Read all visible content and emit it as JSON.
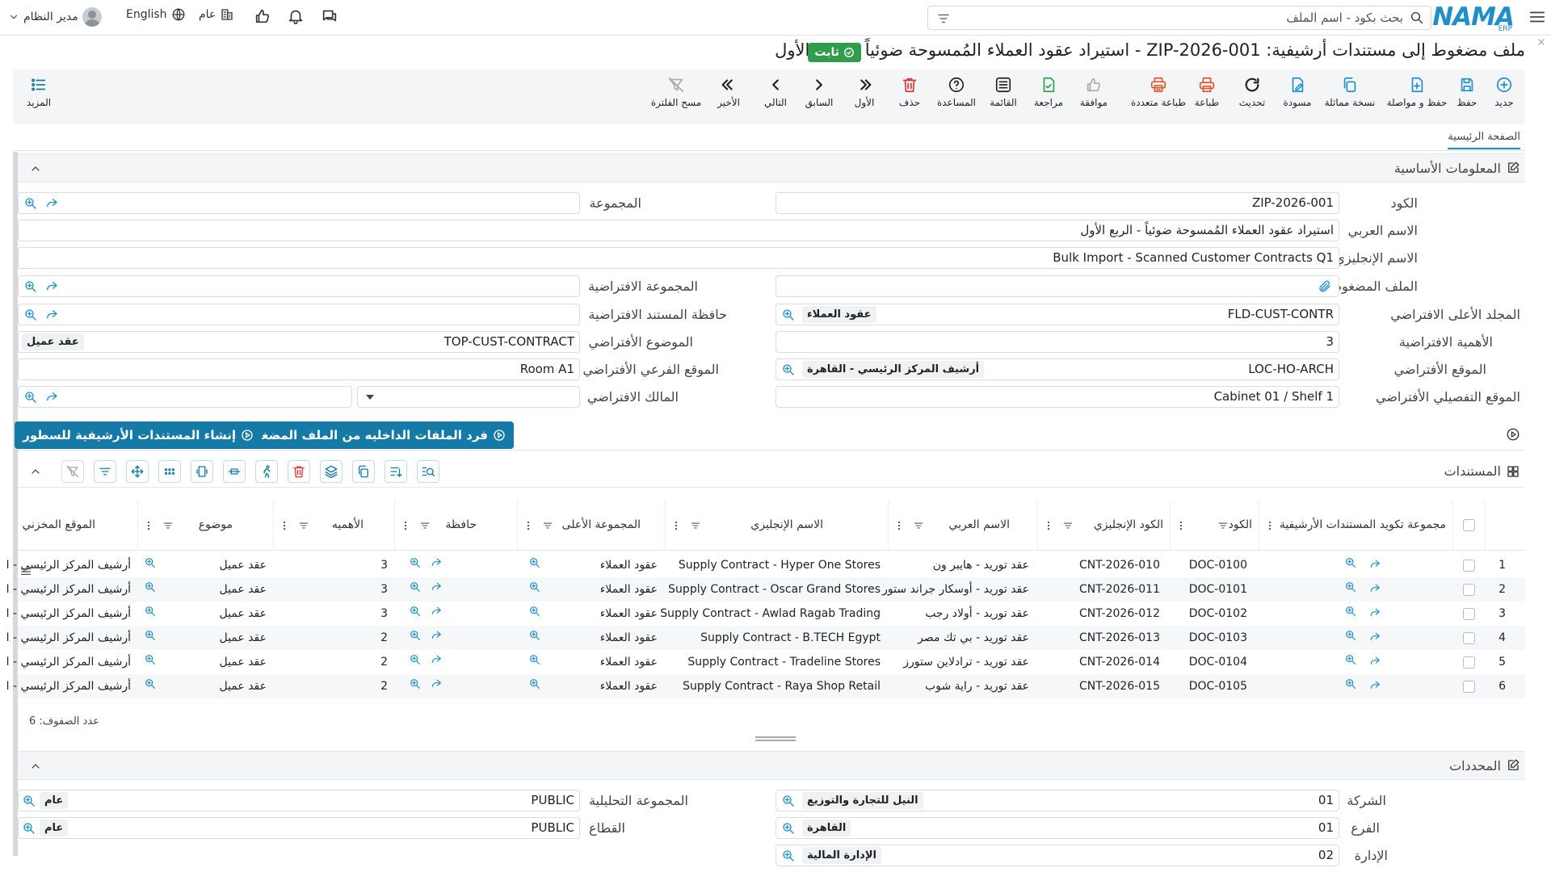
{
  "brand": {
    "logo_text": "NAMA",
    "logo_sub": "ERP"
  },
  "header": {
    "search_placeholder": "بحث بكود - اسم الملف",
    "user_name": "مدير النظام",
    "language": "English",
    "scope": "عام"
  },
  "page": {
    "title": "ملف مضغوط إلى مستندات أرشيفية: ZIP-2026-001 - استيراد عقود العملاء المُمسوحة ضوئياً - الربع الأول",
    "status": "ثابت"
  },
  "toolbar": {
    "more": "المزيد",
    "buttons": [
      {
        "label": "جديد",
        "icon": "plus-circle-icon"
      },
      {
        "label": "حفظ",
        "icon": "save-icon"
      },
      {
        "label": "حفظ و مواصلة",
        "icon": "save-continue-icon"
      },
      {
        "label": "نسخة مماثلة",
        "icon": "copy-icon"
      },
      {
        "label": "مسودة",
        "icon": "draft-icon"
      },
      {
        "label": "تحديث",
        "icon": "refresh-icon"
      },
      {
        "label": "طباعة",
        "icon": "print-icon"
      },
      {
        "label": "طباعة متعددة",
        "icon": "multi-print-icon"
      },
      {
        "label": "موافقة",
        "icon": "approve-icon"
      },
      {
        "label": "مراجعة",
        "icon": "review-icon"
      },
      {
        "label": "القائمة",
        "icon": "list-icon"
      },
      {
        "label": "المساعدة",
        "icon": "help-icon"
      },
      {
        "label": "حذف",
        "icon": "trash-icon"
      },
      {
        "label": "الأول",
        "icon": "first-icon"
      },
      {
        "label": "السابق",
        "icon": "prev-icon"
      },
      {
        "label": "التالي",
        "icon": "next-icon"
      },
      {
        "label": "الأخير",
        "icon": "last-icon"
      },
      {
        "label": "مسح الفلترة",
        "icon": "clear-filter-icon"
      }
    ]
  },
  "tabs": {
    "main": "الصفحة الرئيسية"
  },
  "basic_info": {
    "title": "المعلومات الأساسية",
    "code_label": "الكود",
    "code_value": "ZIP-2026-001",
    "arabic_name_label": "الاسم العربي",
    "arabic_name_value": "استيراد عقود العملاء المُمسوحة ضوئياً - الربع الأول",
    "english_name_label": "الاسم الإنجليزي",
    "english_name_value": "Bulk Import - Scanned Customer Contracts Q1",
    "zip_label": "الملف المضغوط",
    "parent_folder_label": "المجلد الأعلى الافتراضي",
    "parent_folder_code": "FLD-CUST-CONTR",
    "parent_folder_name": "عقود العملاء",
    "importance_label": "الأهمية الافتراضية",
    "importance_value": "3",
    "location_label": "الموقع الأفتراضي",
    "location_code": "LOC-HO-ARCH",
    "location_name": "أرشيف المركز الرئيسي - القاهرة",
    "detail_location_label": "الموقع التفصيلي الأفتراضي",
    "detail_location_value": "Cabinet 01 / Shelf 1",
    "group_label": "المجموعة",
    "default_group_label": "المجموعة الافتراضية",
    "default_keeper_label": "حافظة المستند الافتراضية",
    "default_topic_label": "الموضوع الأفتراضي",
    "default_topic_code": "TOP-CUST-CONTRACT",
    "default_topic_name": "عقد عميل",
    "sub_location_label": "الموقع الفرعي الأفتراضي",
    "sub_location_value": "Room A1",
    "owner_label": "المالك الافتراضي"
  },
  "actions": {
    "extract": "فرد الملفات الداخليه من الملف المضغوط",
    "create_docs": "إنشاء المستندات الأرشيفية للسطور"
  },
  "documents": {
    "title": "المستندات",
    "columns": [
      "مجموعة تكويد المستندات الأرشيفية",
      "الكود",
      "الكود الإنجليزي",
      "الاسم العربي",
      "الاسم الإنجليزي",
      "المجموعة الأعلى",
      "حافظة",
      "الأهميه",
      "موضوع",
      "الموقع المخزني"
    ],
    "rows": [
      {
        "n": "1",
        "code": "DOC-0100",
        "en_code": "CNT-2026-010",
        "ar_name": "عقد توريد - هايبر ون",
        "en_name": "Supply Contract - Hyper One Stores",
        "parent": "عقود العملاء",
        "imp": "3",
        "topic": "عقد عميل",
        "loc": "أرشيف المركز الرئيسي - ا"
      },
      {
        "n": "2",
        "code": "DOC-0101",
        "en_code": "CNT-2026-011",
        "ar_name": "عقد توريد - أوسكار جراند ستور",
        "en_name": "Supply Contract - Oscar Grand Stores",
        "parent": "عقود العملاء",
        "imp": "3",
        "topic": "عقد عميل",
        "loc": "أرشيف المركز الرئيسي - ا"
      },
      {
        "n": "3",
        "code": "DOC-0102",
        "en_code": "CNT-2026-012",
        "ar_name": "عقد توريد - أولاد رجب",
        "en_name": "Supply Contract - Awlad Ragab Trading",
        "parent": "عقود العملاء",
        "imp": "3",
        "topic": "عقد عميل",
        "loc": "أرشيف المركز الرئيسي - ا"
      },
      {
        "n": "4",
        "code": "DOC-0103",
        "en_code": "CNT-2026-013",
        "ar_name": "عقد توريد - بي تك مصر",
        "en_name": "Supply Contract - B.TECH Egypt",
        "parent": "عقود العملاء",
        "imp": "2",
        "topic": "عقد عميل",
        "loc": "أرشيف المركز الرئيسي - ا"
      },
      {
        "n": "5",
        "code": "DOC-0104",
        "en_code": "CNT-2026-014",
        "ar_name": "عقد توريد - ترادلاين ستورز",
        "en_name": "Supply Contract - Tradeline Stores",
        "parent": "عقود العملاء",
        "imp": "2",
        "topic": "عقد عميل",
        "loc": "أرشيف المركز الرئيسي - ا"
      },
      {
        "n": "6",
        "code": "DOC-0105",
        "en_code": "CNT-2026-015",
        "ar_name": "عقد توريد - راية شوب",
        "en_name": "Supply Contract - Raya Shop Retail",
        "parent": "عقود العملاء",
        "imp": "2",
        "topic": "عقد عميل",
        "loc": "أرشيف المركز الرئيسي - ا"
      }
    ],
    "row_count": "عدد الصفوف: 6"
  },
  "dimensions": {
    "title": "المحددات",
    "company_label": "الشركة",
    "company_code": "01",
    "company_name": "النيل للتجارة والتوزيع",
    "branch_label": "الفرع",
    "branch_code": "01",
    "branch_name": "القاهرة",
    "department_label": "الإدارة",
    "department_code": "02",
    "department_name": "الإدارة المالية",
    "analytic_label": "المجموعة التحليلية",
    "analytic_code": "PUBLIC",
    "analytic_name": "عام",
    "sector_label": "القطاع",
    "sector_code": "PUBLIC",
    "sector_name": "عام"
  }
}
